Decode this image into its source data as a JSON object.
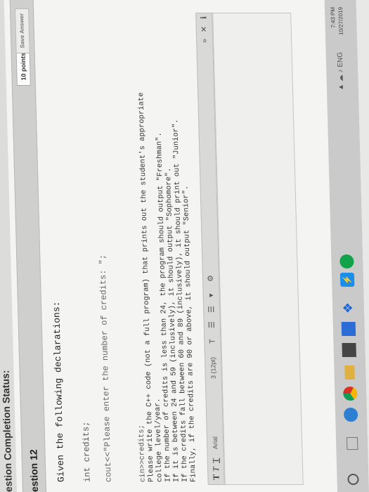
{
  "status_bar": {
    "title": "estion Completion Status:"
  },
  "question": {
    "label": "estion 12",
    "points": "10 points",
    "save_label": "Save Answer"
  },
  "prompt": {
    "intro": "Given the following declarations:",
    "decl1": "int credits;",
    "decl2": "cout<<\"Please enter the number of credits: \";",
    "lines": [
      "cin>>credits;",
      "Please write the C++ code (not a full program) that prints out the student's appropriate",
      "college level/year.",
      "If the number of credits is less than 24, the program should output \"Freshman\".",
      "If it is between 24 and 59 (inclusively), it should output \"Sophomore\".",
      "If the credits fall between 60 and 89 (inclusively), it should print out \"Junior\".",
      "Finally, if the credits are 90 or above, it should output \"Senior\"."
    ]
  },
  "editor_toolbar": {
    "bold": "T",
    "italic": "T",
    "underline": "T",
    "font_family": "Arial",
    "font_size": "3 (12pt)",
    "tools": [
      "T",
      "☰",
      "☰",
      "▾",
      "⚙"
    ],
    "right_tools": [
      "»",
      "✕",
      "ℹ"
    ]
  },
  "taskbar": {
    "tray_icons": "▲ ☁ ♪ ENG",
    "time": "7:43 PM",
    "date": "10/27/2019"
  }
}
